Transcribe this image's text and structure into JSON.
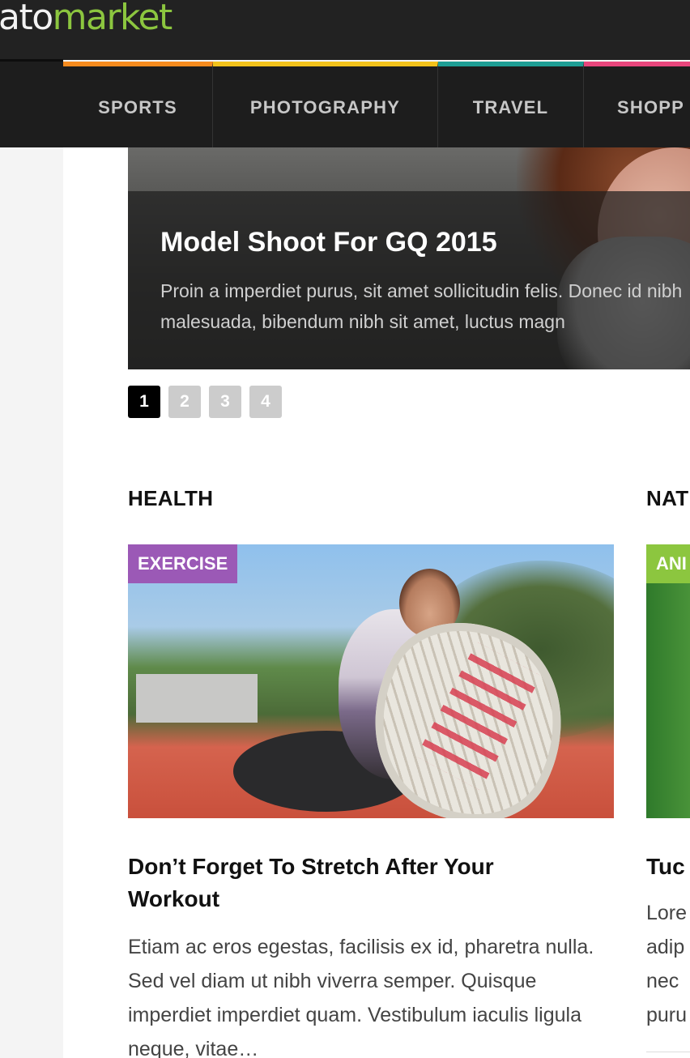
{
  "header": {
    "logo_part1": "ato",
    "logo_part2": "market",
    "colors": {
      "background": "#222222",
      "logo_accent": "#8cc63f"
    }
  },
  "nav": {
    "items": [
      {
        "label": "SPORTS",
        "accent": "#f68b1f"
      },
      {
        "label": "PHOTOGRAPHY",
        "accent": "#f2c21b"
      },
      {
        "label": "TRAVEL",
        "accent": "#1f9e95"
      },
      {
        "label": "SHOPP",
        "accent": "#e8467c"
      }
    ]
  },
  "slider": {
    "title": "Model Shoot For GQ 2015",
    "excerpt": "Proin a imperdiet purus, sit amet sollicitudin felis. Donec id nibh malesuada, bibendum nibh sit amet, luctus magn",
    "pages": [
      "1",
      "2",
      "3",
      "4"
    ],
    "active_page": "1"
  },
  "sections": {
    "health": {
      "title": "HEALTH",
      "badge": "EXERCISE",
      "badge_color": "#9b59b6",
      "post_title": "Don’t Forget To Stretch After Your Workout",
      "excerpt": "Etiam ac eros egestas, facilisis ex id, pharetra nulla. Sed vel diam ut nibh viverra semper. Quisque imperdiet imperdiet quam. Vestibulum iaculis ligula neque, vitae…"
    },
    "nature": {
      "title": "NAT",
      "badge": "ANI",
      "badge_color": "#8cc63f",
      "post_title": "Tuc",
      "excerpt": "Lore\nadip\nnec\npuru"
    }
  }
}
